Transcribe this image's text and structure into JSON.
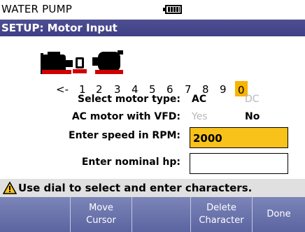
{
  "title": "WATER PUMP",
  "setup_title": "SETUP: Motor Input",
  "char_picker": {
    "items": [
      "<-",
      "1",
      "2",
      "3",
      "4",
      "5",
      "6",
      "7",
      "8",
      "9",
      "0"
    ],
    "selected": "0"
  },
  "motor_type": {
    "label": "Select motor type:",
    "options": [
      "AC",
      "DC"
    ],
    "selected": "AC"
  },
  "vfd": {
    "label": "AC motor with VFD:",
    "options": [
      "Yes",
      "No"
    ],
    "selected": "No"
  },
  "speed": {
    "label": "Enter speed in RPM:",
    "value": "2000"
  },
  "hp": {
    "label": "Enter nominal hp:",
    "value": ""
  },
  "hint": "Use dial to select and enter characters.",
  "softkeys": [
    {
      "line1": "",
      "line2": ""
    },
    {
      "line1": "Move",
      "line2": "Cursor"
    },
    {
      "line1": "",
      "line2": ""
    },
    {
      "line1": "Delete",
      "line2": "Character"
    },
    {
      "line1": "",
      "line2": "Done"
    }
  ],
  "colors": {
    "header_bar": "#3f3f84",
    "highlight": "#f8b400",
    "softkey_bar": "#5b64a0",
    "hint_bar": "#e0e0e0"
  }
}
